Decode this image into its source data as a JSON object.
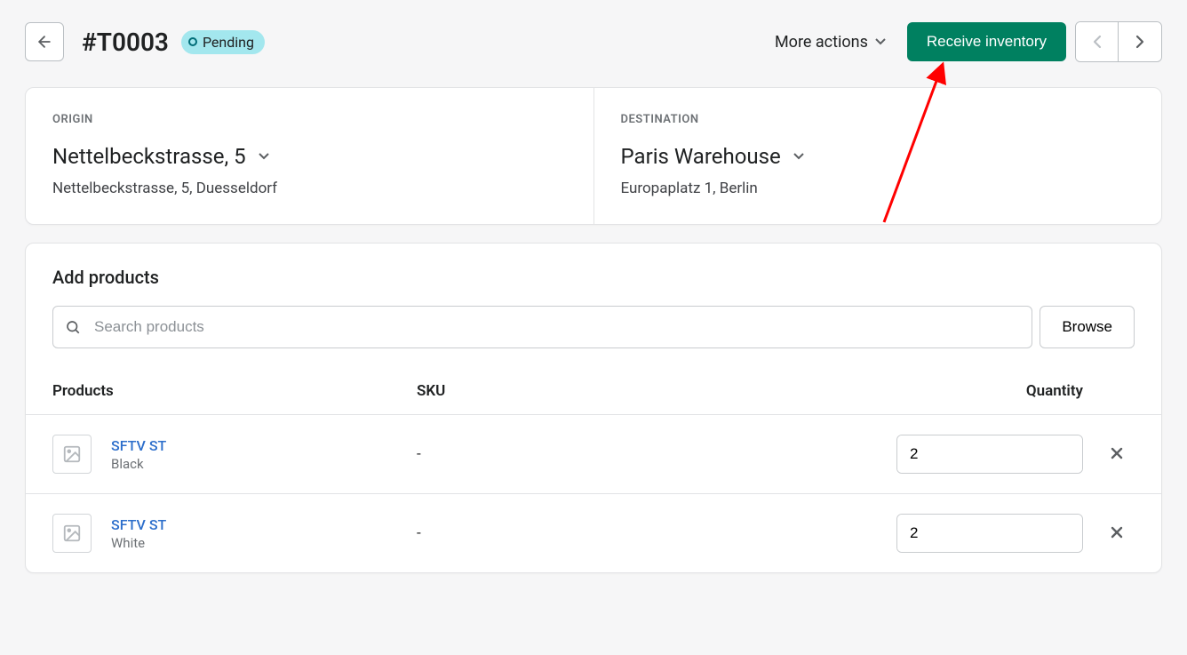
{
  "header": {
    "title": "#T0003",
    "badge": "Pending",
    "more_actions": "More actions",
    "receive_btn": "Receive inventory"
  },
  "origin": {
    "label": "ORIGIN",
    "name": "Nettelbeckstrasse, 5",
    "address": "Nettelbeckstrasse, 5, Duesseldorf"
  },
  "destination": {
    "label": "DESTINATION",
    "name": "Paris Warehouse",
    "address": "Europaplatz 1, Berlin"
  },
  "products": {
    "title": "Add products",
    "search_placeholder": "Search products",
    "browse": "Browse",
    "columns": {
      "products": "Products",
      "sku": "SKU",
      "quantity": "Quantity"
    },
    "rows": [
      {
        "name": "SFTV ST",
        "variant": "Black",
        "sku": "-",
        "qty": "2"
      },
      {
        "name": "SFTV ST",
        "variant": "White",
        "sku": "-",
        "qty": "2"
      }
    ]
  }
}
